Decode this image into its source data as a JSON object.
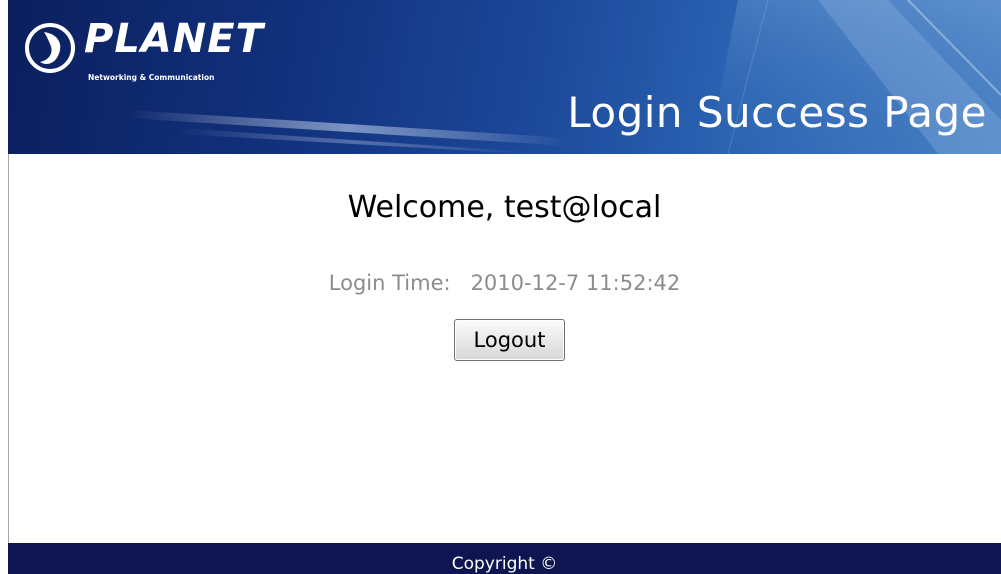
{
  "header": {
    "logo_text": "PLANET",
    "logo_tagline": "Networking & Communication",
    "title": "Login Success Page"
  },
  "main": {
    "welcome": "Welcome, test@local",
    "login_time_label": "Login Time:",
    "login_time_value": "2010-12-7 11:52:42",
    "logout_label": "Logout"
  },
  "footer": {
    "copyright": "Copyright ©"
  },
  "colors": {
    "banner": "#12327e",
    "footer": "#0e1550",
    "muted_text": "#8c8c8c"
  }
}
